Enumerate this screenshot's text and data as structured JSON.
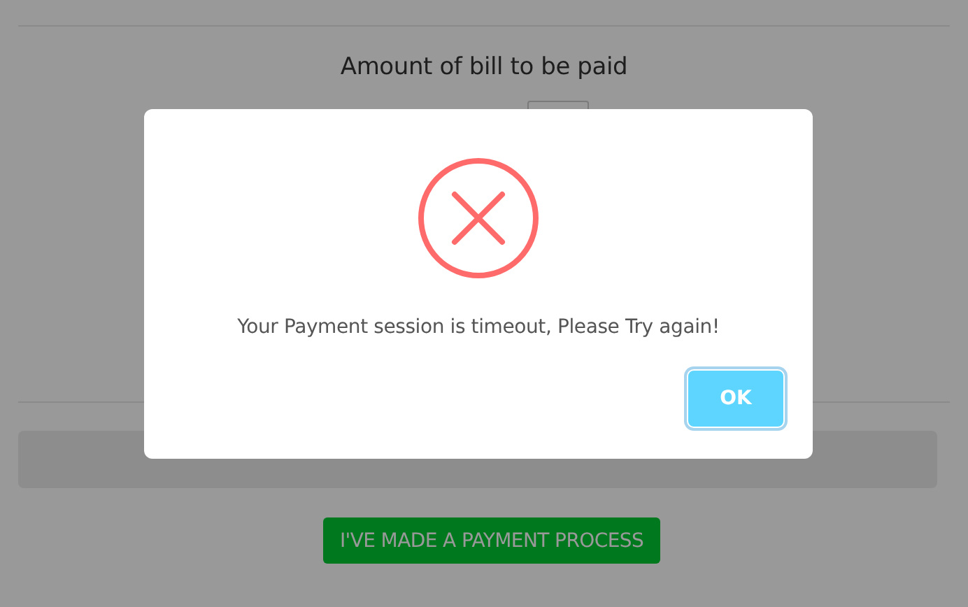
{
  "page": {
    "heading": "Amount of bill to be paid",
    "confirm_button": "I'VE MADE A PAYMENT PROCESS"
  },
  "alert": {
    "kind": "error",
    "message": "Your Payment session is timeout, Please Try again!",
    "button": "OK"
  }
}
